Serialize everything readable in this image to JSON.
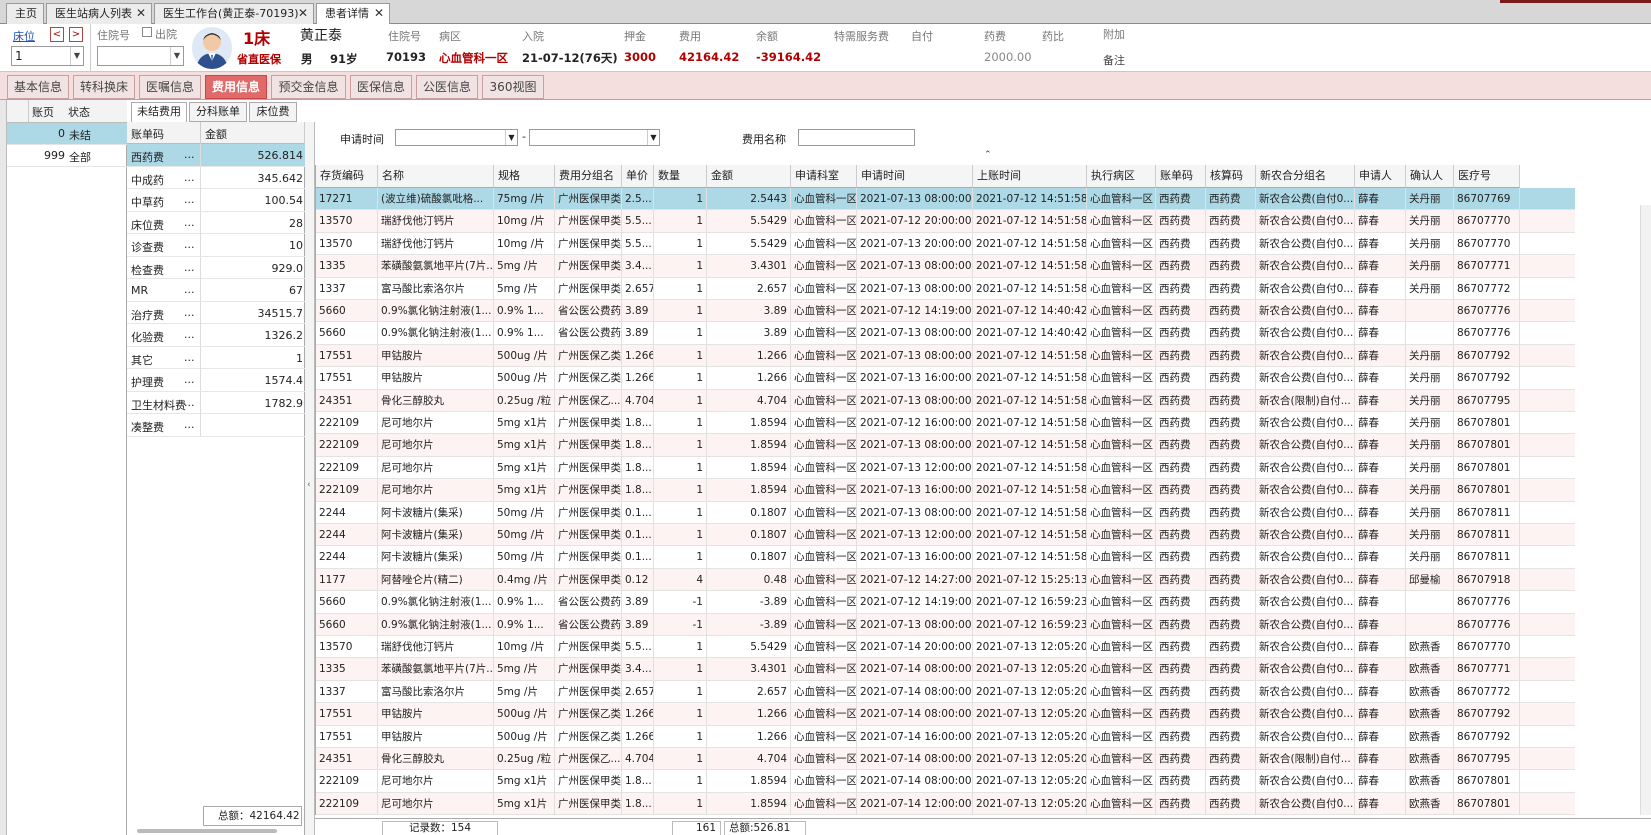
{
  "doc_tabs": [
    "主页",
    "医生站病人列表",
    "医生工作台(黄正泰-70193)",
    "患者详情"
  ],
  "header": {
    "bed_link": "床位",
    "prev": "<",
    "next": ">",
    "bed_select": "1",
    "admission_no_label": "住院号",
    "discharged_label": "出院",
    "bed_no": "1床",
    "insurance": "省直医保",
    "patient_name": "黄正泰",
    "gender": "男",
    "age": "91岁",
    "labels": {
      "admission_no": "住院号",
      "ward": "病区",
      "admit": "入院",
      "deposit": "押金",
      "cost": "费用",
      "balance": "余额",
      "special": "特需服务费",
      "self_pay": "自付",
      "drug_fee": "药费",
      "drug_ratio": "药比",
      "extra": "附加"
    },
    "values": {
      "admission_no": "70193",
      "ward": "心血管科一区",
      "admit": "21-07-12(76天)",
      "deposit": "3000",
      "cost": "42164.42",
      "balance": "-39164.42",
      "drug_fee": "2000.00",
      "remark": "备注"
    }
  },
  "sub_tabs": [
    "基本信息",
    "转科换床",
    "医嘱信息",
    "费用信息",
    "预交金信息",
    "医保信息",
    "公医信息",
    "360视图"
  ],
  "left_nav": {
    "headers": [
      "账页",
      "状态"
    ],
    "rows": [
      {
        "page": "0",
        "status": "未结"
      },
      {
        "page": "999",
        "status": "全部"
      }
    ]
  },
  "inner_tabs": [
    "未结费用",
    "分科账单",
    "床位费"
  ],
  "categories": {
    "headers": [
      "账单码",
      "金额"
    ],
    "rows": [
      {
        "name": "西药费",
        "amount": "526.814"
      },
      {
        "name": "中成药",
        "amount": "345.642"
      },
      {
        "name": "中草药",
        "amount": "100.54"
      },
      {
        "name": "床位费",
        "amount": "28"
      },
      {
        "name": "诊查费",
        "amount": "10"
      },
      {
        "name": "检查费",
        "amount": "929.0"
      },
      {
        "name": "MR",
        "amount": "67"
      },
      {
        "name": "治疗费",
        "amount": "34515.7"
      },
      {
        "name": "化验费",
        "amount": "1326.2"
      },
      {
        "name": "其它",
        "amount": "1"
      },
      {
        "name": "护理费",
        "amount": "1574.4"
      },
      {
        "name": "卫生材料费",
        "amount": "1782.9"
      },
      {
        "name": "凑整费",
        "amount": ""
      }
    ],
    "dots": "...",
    "total": "总额：42164.42"
  },
  "filters": {
    "apply_time_label": "申请时间",
    "dash": "-",
    "fee_name_label": "费用名称"
  },
  "table": {
    "headers": [
      "存货编码",
      "名称",
      "规格",
      "费用分组名",
      "单价",
      "数量",
      "金额",
      "申请科室",
      "申请时间",
      "上账时间",
      "执行病区",
      "账单码",
      "核算码",
      "新农合分组名",
      "申请人",
      "确认人",
      "医疗号"
    ],
    "rows": [
      [
        "17271",
        "(波立维)硫酸氯吡格...",
        "75mg /片",
        "广州医保甲类",
        "2.5...",
        "1",
        "2.5443",
        "心血管科一区",
        "2021-07-13 08:00:00",
        "2021-07-12 14:51:58",
        "心血管科一区",
        "西药费",
        "西药费",
        "新农合公费(自付0...",
        "薛春",
        "关丹丽",
        "86707769"
      ],
      [
        "13570",
        "瑞舒伐他汀钙片",
        "10mg /片",
        "广州医保甲类",
        "5.5...",
        "1",
        "5.5429",
        "心血管科一区",
        "2021-07-12 20:00:00",
        "2021-07-12 14:51:58",
        "心血管科一区",
        "西药费",
        "西药费",
        "新农合公费(自付0...",
        "薛春",
        "关丹丽",
        "86707770"
      ],
      [
        "13570",
        "瑞舒伐他汀钙片",
        "10mg /片",
        "广州医保甲类",
        "5.5...",
        "1",
        "5.5429",
        "心血管科一区",
        "2021-07-13 20:00:00",
        "2021-07-12 14:51:58",
        "心血管科一区",
        "西药费",
        "西药费",
        "新农合公费(自付0...",
        "薛春",
        "关丹丽",
        "86707770"
      ],
      [
        "1335",
        "苯磺酸氨氯地平片(7片...",
        "5mg /片",
        "广州医保甲类",
        "3.4...",
        "1",
        "3.4301",
        "心血管科一区",
        "2021-07-13 08:00:00",
        "2021-07-12 14:51:58",
        "心血管科一区",
        "西药费",
        "西药费",
        "新农合公费(自付0...",
        "薛春",
        "关丹丽",
        "86707771"
      ],
      [
        "1337",
        "富马酸比索洛尔片",
        "5mg /片",
        "广州医保甲类",
        "2.657",
        "1",
        "2.657",
        "心血管科一区",
        "2021-07-13 08:00:00",
        "2021-07-12 14:51:58",
        "心血管科一区",
        "西药费",
        "西药费",
        "新农合公费(自付0...",
        "薛春",
        "关丹丽",
        "86707772"
      ],
      [
        "5660",
        "0.9%氯化钠注射液(1...",
        "0.9%  1...",
        "省公医公费药",
        "3.89",
        "1",
        "3.89",
        "心血管科一区",
        "2021-07-12 14:19:00",
        "2021-07-12 14:40:42",
        "心血管科一区",
        "西药费",
        "西药费",
        "新农合公费(自付0...",
        "薛春",
        "",
        "86707776"
      ],
      [
        "5660",
        "0.9%氯化钠注射液(1...",
        "0.9%  1...",
        "省公医公费药",
        "3.89",
        "1",
        "3.89",
        "心血管科一区",
        "2021-07-13 08:00:00",
        "2021-07-12 14:40:42",
        "心血管科一区",
        "西药费",
        "西药费",
        "新农合公费(自付0...",
        "薛春",
        "",
        "86707776"
      ],
      [
        "17551",
        "甲钴胺片",
        "500ug /片",
        "广州医保乙类",
        "1.266",
        "1",
        "1.266",
        "心血管科一区",
        "2021-07-13 08:00:00",
        "2021-07-12 14:51:58",
        "心血管科一区",
        "西药费",
        "西药费",
        "新农合公费(自付0...",
        "薛春",
        "关丹丽",
        "86707792"
      ],
      [
        "17551",
        "甲钴胺片",
        "500ug /片",
        "广州医保乙类",
        "1.266",
        "1",
        "1.266",
        "心血管科一区",
        "2021-07-13 16:00:00",
        "2021-07-12 14:51:58",
        "心血管科一区",
        "西药费",
        "西药费",
        "新农合公费(自付0...",
        "薛春",
        "关丹丽",
        "86707792"
      ],
      [
        "24351",
        "骨化三醇胶丸",
        "0.25ug /粒",
        "广州医保乙...",
        "4.704",
        "1",
        "4.704",
        "心血管科一区",
        "2021-07-13 08:00:00",
        "2021-07-12 14:51:58",
        "心血管科一区",
        "西药费",
        "西药费",
        "新农合(限制)自付...",
        "薛春",
        "关丹丽",
        "86707795"
      ],
      [
        "222109",
        "尼可地尔片",
        "5mg x1片",
        "广州医保甲类",
        "1.8...",
        "1",
        "1.8594",
        "心血管科一区",
        "2021-07-12 16:00:00",
        "2021-07-12 14:51:58",
        "心血管科一区",
        "西药费",
        "西药费",
        "新农合公费(自付0...",
        "薛春",
        "关丹丽",
        "86707801"
      ],
      [
        "222109",
        "尼可地尔片",
        "5mg x1片",
        "广州医保甲类",
        "1.8...",
        "1",
        "1.8594",
        "心血管科一区",
        "2021-07-13 08:00:00",
        "2021-07-12 14:51:58",
        "心血管科一区",
        "西药费",
        "西药费",
        "新农合公费(自付0...",
        "薛春",
        "关丹丽",
        "86707801"
      ],
      [
        "222109",
        "尼可地尔片",
        "5mg x1片",
        "广州医保甲类",
        "1.8...",
        "1",
        "1.8594",
        "心血管科一区",
        "2021-07-13 12:00:00",
        "2021-07-12 14:51:58",
        "心血管科一区",
        "西药费",
        "西药费",
        "新农合公费(自付0...",
        "薛春",
        "关丹丽",
        "86707801"
      ],
      [
        "222109",
        "尼可地尔片",
        "5mg x1片",
        "广州医保甲类",
        "1.8...",
        "1",
        "1.8594",
        "心血管科一区",
        "2021-07-13 16:00:00",
        "2021-07-12 14:51:58",
        "心血管科一区",
        "西药费",
        "西药费",
        "新农合公费(自付0...",
        "薛春",
        "关丹丽",
        "86707801"
      ],
      [
        "2244",
        "阿卡波糖片(集采)",
        "50mg /片",
        "广州医保甲类",
        "0.1...",
        "1",
        "0.1807",
        "心血管科一区",
        "2021-07-13 08:00:00",
        "2021-07-12 14:51:58",
        "心血管科一区",
        "西药费",
        "西药费",
        "新农合公费(自付0...",
        "薛春",
        "关丹丽",
        "86707811"
      ],
      [
        "2244",
        "阿卡波糖片(集采)",
        "50mg /片",
        "广州医保甲类",
        "0.1...",
        "1",
        "0.1807",
        "心血管科一区",
        "2021-07-13 12:00:00",
        "2021-07-12 14:51:58",
        "心血管科一区",
        "西药费",
        "西药费",
        "新农合公费(自付0...",
        "薛春",
        "关丹丽",
        "86707811"
      ],
      [
        "2244",
        "阿卡波糖片(集采)",
        "50mg /片",
        "广州医保甲类",
        "0.1...",
        "1",
        "0.1807",
        "心血管科一区",
        "2021-07-13 16:00:00",
        "2021-07-12 14:51:58",
        "心血管科一区",
        "西药费",
        "西药费",
        "新农合公费(自付0...",
        "薛春",
        "关丹丽",
        "86707811"
      ],
      [
        "1177",
        "阿替唑仑片(精二)",
        "0.4mg /片",
        "广州医保甲类",
        "0.12",
        "4",
        "0.48",
        "心血管科一区",
        "2021-07-12 14:27:00",
        "2021-07-12 15:25:13",
        "心血管科一区",
        "西药费",
        "西药费",
        "新农合公费(自付0...",
        "薛春",
        "邱曼榆",
        "86707918"
      ],
      [
        "5660",
        "0.9%氯化钠注射液(1...",
        "0.9%  1...",
        "省公医公费药",
        "3.89",
        "-1",
        "-3.89",
        "心血管科一区",
        "2021-07-12 14:19:00",
        "2021-07-12 16:59:23",
        "心血管科一区",
        "西药费",
        "西药费",
        "新农合公费(自付0...",
        "薛春",
        "",
        "86707776"
      ],
      [
        "5660",
        "0.9%氯化钠注射液(1...",
        "0.9%  1...",
        "省公医公费药",
        "3.89",
        "-1",
        "-3.89",
        "心血管科一区",
        "2021-07-13 08:00:00",
        "2021-07-12 16:59:23",
        "心血管科一区",
        "西药费",
        "西药费",
        "新农合公费(自付0...",
        "薛春",
        "",
        "86707776"
      ],
      [
        "13570",
        "瑞舒伐他汀钙片",
        "10mg /片",
        "广州医保甲类",
        "5.5...",
        "1",
        "5.5429",
        "心血管科一区",
        "2021-07-14 20:00:00",
        "2021-07-13 12:05:20",
        "心血管科一区",
        "西药费",
        "西药费",
        "新农合公费(自付0...",
        "薛春",
        "欧燕香",
        "86707770"
      ],
      [
        "1335",
        "苯磺酸氨氯地平片(7片...",
        "5mg /片",
        "广州医保甲类",
        "3.4...",
        "1",
        "3.4301",
        "心血管科一区",
        "2021-07-14 08:00:00",
        "2021-07-13 12:05:20",
        "心血管科一区",
        "西药费",
        "西药费",
        "新农合公费(自付0...",
        "薛春",
        "欧燕香",
        "86707771"
      ],
      [
        "1337",
        "富马酸比索洛尔片",
        "5mg /片",
        "广州医保甲类",
        "2.657",
        "1",
        "2.657",
        "心血管科一区",
        "2021-07-14 08:00:00",
        "2021-07-13 12:05:20",
        "心血管科一区",
        "西药费",
        "西药费",
        "新农合公费(自付0...",
        "薛春",
        "欧燕香",
        "86707772"
      ],
      [
        "17551",
        "甲钴胺片",
        "500ug /片",
        "广州医保乙类",
        "1.266",
        "1",
        "1.266",
        "心血管科一区",
        "2021-07-14 08:00:00",
        "2021-07-13 12:05:20",
        "心血管科一区",
        "西药费",
        "西药费",
        "新农合公费(自付0...",
        "薛春",
        "欧燕香",
        "86707792"
      ],
      [
        "17551",
        "甲钴胺片",
        "500ug /片",
        "广州医保乙类",
        "1.266",
        "1",
        "1.266",
        "心血管科一区",
        "2021-07-14 16:00:00",
        "2021-07-13 12:05:20",
        "心血管科一区",
        "西药费",
        "西药费",
        "新农合公费(自付0...",
        "薛春",
        "欧燕香",
        "86707792"
      ],
      [
        "24351",
        "骨化三醇胶丸",
        "0.25ug /粒",
        "广州医保乙...",
        "4.704",
        "1",
        "4.704",
        "心血管科一区",
        "2021-07-14 08:00:00",
        "2021-07-13 12:05:20",
        "心血管科一区",
        "西药费",
        "西药费",
        "新农合(限制)自付...",
        "薛春",
        "欧燕香",
        "86707795"
      ],
      [
        "222109",
        "尼可地尔片",
        "5mg x1片",
        "广州医保甲类",
        "1.8...",
        "1",
        "1.8594",
        "心血管科一区",
        "2021-07-14 08:00:00",
        "2021-07-13 12:05:20",
        "心血管科一区",
        "西药费",
        "西药费",
        "新农合公费(自付0...",
        "薛春",
        "欧燕香",
        "86707801"
      ],
      [
        "222109",
        "尼可地尔片",
        "5mg x1片",
        "广州医保甲类",
        "1.8...",
        "1",
        "1.8594",
        "心血管科一区",
        "2021-07-14 12:00:00",
        "2021-07-13 12:05:20",
        "心血管科一区",
        "西药费",
        "西药费",
        "新农合公费(自付0...",
        "薛春",
        "欧燕香",
        "86707801"
      ]
    ]
  },
  "footer": {
    "record_count": "记录数：154",
    "qty_sum": "161",
    "total": "总额:526.81"
  }
}
